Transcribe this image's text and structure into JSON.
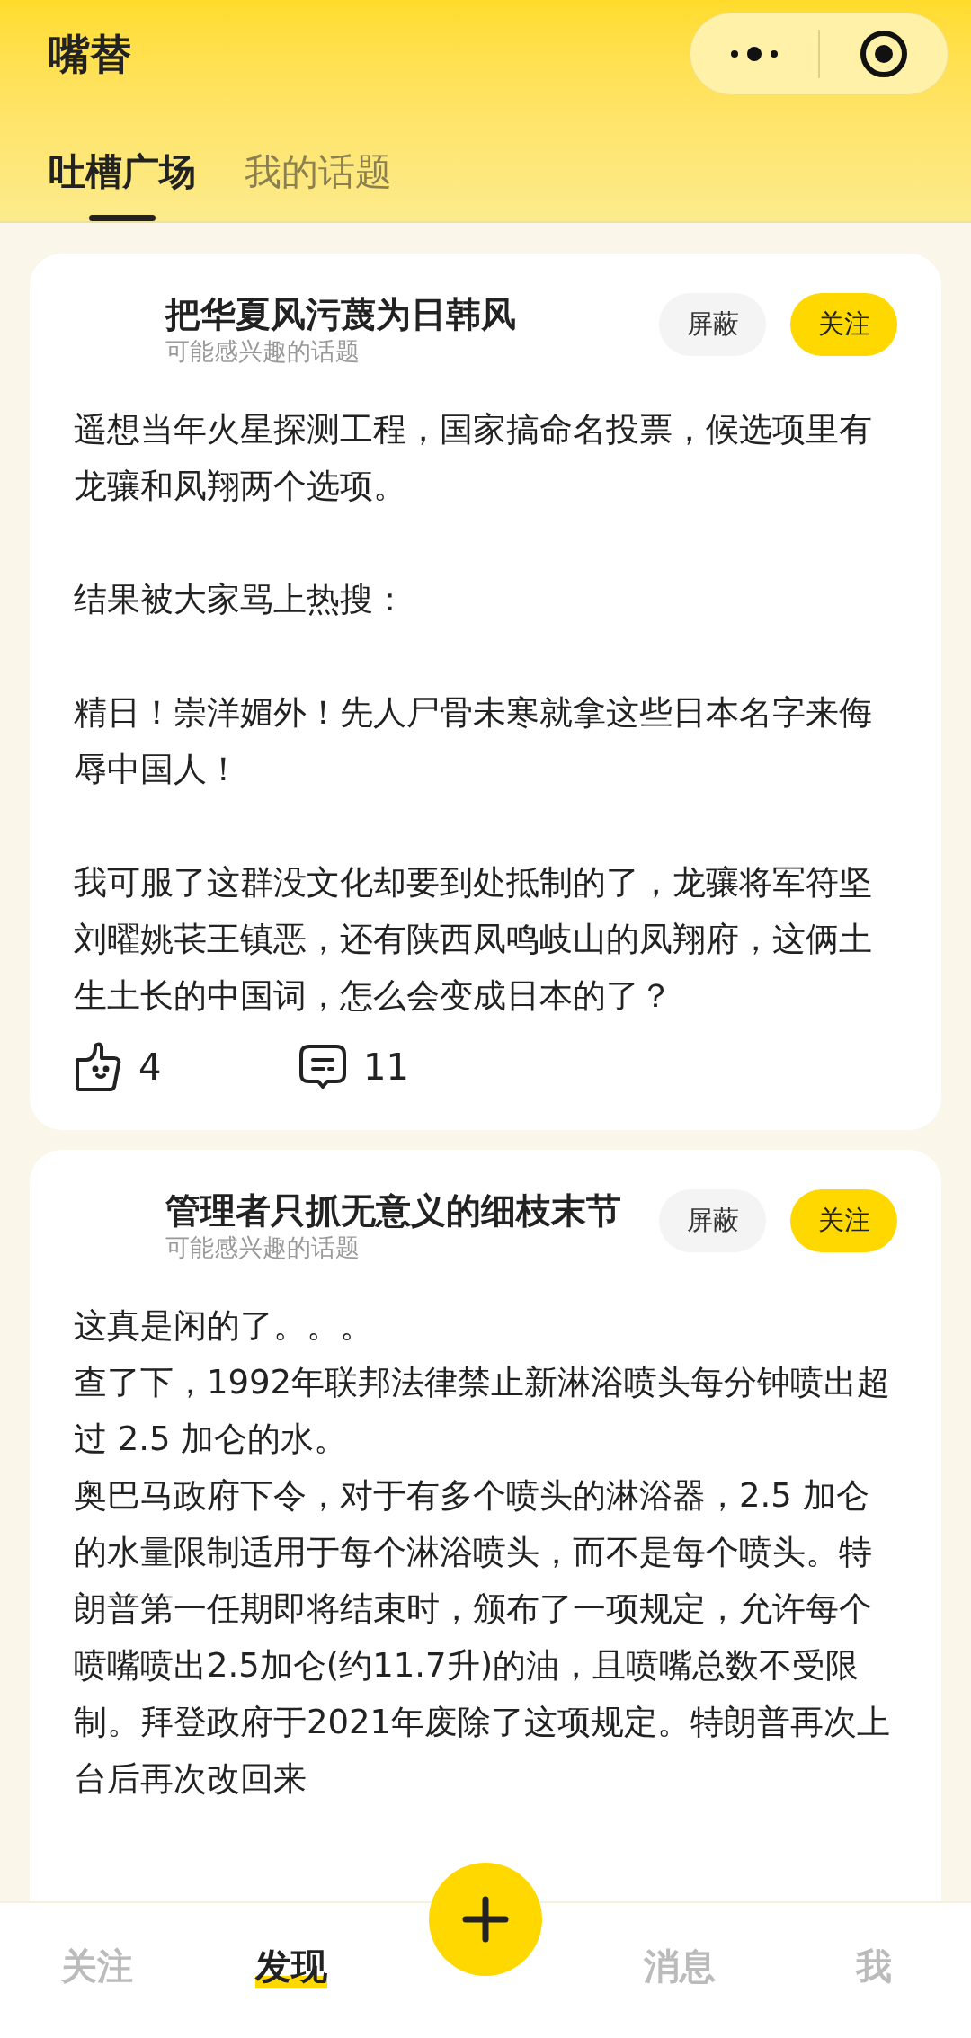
{
  "app": {
    "title": "嘴替"
  },
  "tabs": [
    {
      "label": "吐槽广场",
      "selected": true
    },
    {
      "label": "我的话题",
      "selected": false
    }
  ],
  "posts": [
    {
      "topic": "把华夏风污蔑为日韩风",
      "subtitle": "可能感兴趣的话题",
      "block_label": "屏蔽",
      "follow_label": "关注",
      "spaced": true,
      "paragraphs": [
        "遥想当年火星探测工程，国家搞命名投票，候选项里有龙骧和凤翔两个选项。",
        "结果被大家骂上热搜：",
        "精日！崇洋媚外！先人尸骨未寒就拿这些日本名字来侮辱中国人！",
        "我可服了这群没文化却要到处抵制的了，龙骧将军符坚刘曜姚苌王镇恶，还有陕西凤鸣岐山的凤翔府，这俩土生土长的中国词，怎么会变成日本的了？"
      ],
      "likes": "4",
      "comments": "11"
    },
    {
      "topic": "管理者只抓无意义的细枝末节",
      "subtitle": "可能感兴趣的话题",
      "block_label": "屏蔽",
      "follow_label": "关注",
      "spaced": false,
      "paragraphs": [
        "这真是闲的了。。。",
        "查了下，1992年联邦法律禁止新淋浴喷头每分钟喷出超过 2.5 加仑的水。",
        "奥巴马政府下令，对于有多个喷头的淋浴器，2.5 加仑的水量限制适用于每个淋浴喷头，而不是每个喷头。特朗普第一任期即将结束时，颁布了一项规定，允许每个喷嘴喷出2.5加仑(约11.7升)的油，且喷嘴总数不受限制。拜登政府于2021年废除了这项规定。特朗普再次上台后再次改回来"
      ]
    }
  ],
  "bottom_nav": [
    {
      "label": "关注",
      "selected": false
    },
    {
      "label": "发现",
      "selected": true
    },
    {
      "label": "消息",
      "selected": false
    },
    {
      "label": "我",
      "selected": false
    }
  ]
}
